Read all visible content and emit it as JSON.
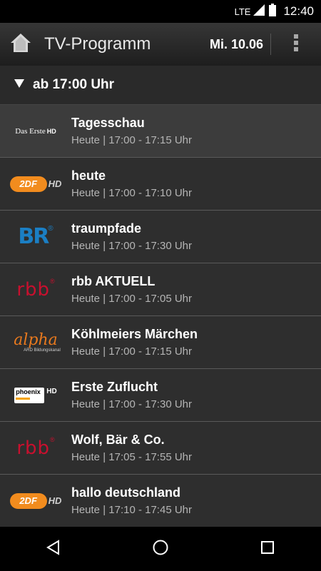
{
  "status": {
    "network": "LTE",
    "time": "12:40"
  },
  "header": {
    "title": "TV-Programm",
    "date": "Mi. 10.06"
  },
  "filter": {
    "label": "ab 17:00 Uhr"
  },
  "programs": [
    {
      "channel": "das-erste-hd",
      "title": "Tagesschau",
      "time": "Heute | 17:00 - 17:15 Uhr"
    },
    {
      "channel": "zdf-hd",
      "title": "heute",
      "time": "Heute | 17:00 - 17:10 Uhr"
    },
    {
      "channel": "br",
      "title": "traumpfade",
      "time": "Heute | 17:00 - 17:30 Uhr"
    },
    {
      "channel": "rbb",
      "title": "rbb AKTUELL",
      "time": "Heute | 17:00 - 17:05 Uhr"
    },
    {
      "channel": "ard-alpha",
      "title": "Köhlmeiers Märchen",
      "time": "Heute | 17:00 - 17:15 Uhr"
    },
    {
      "channel": "phoenix-hd",
      "title": "Erste Zuflucht",
      "time": "Heute | 17:00 - 17:30 Uhr"
    },
    {
      "channel": "rbb",
      "title": "Wolf, Bär & Co.",
      "time": "Heute | 17:05 - 17:55 Uhr"
    },
    {
      "channel": "zdf-hd",
      "title": "hallo deutschland",
      "time": "Heute | 17:10 - 17:45 Uhr"
    }
  ],
  "logos": {
    "das_erste": "Das Erste",
    "das_erste_hd": "HD",
    "zdf": "2DF",
    "zdf_hd": "HD",
    "br": "BR",
    "rbb": "rbb",
    "alpha": "alpha",
    "alpha_sub": "ARD Bildungskanal",
    "phoenix": "phoenix",
    "phoenix_hd": "HD"
  },
  "colors": {
    "zdf_orange": "#f28c1e",
    "br_blue": "#1b7fc4",
    "rbb_red": "#c8102e",
    "alpha_orange": "#e8791e"
  }
}
